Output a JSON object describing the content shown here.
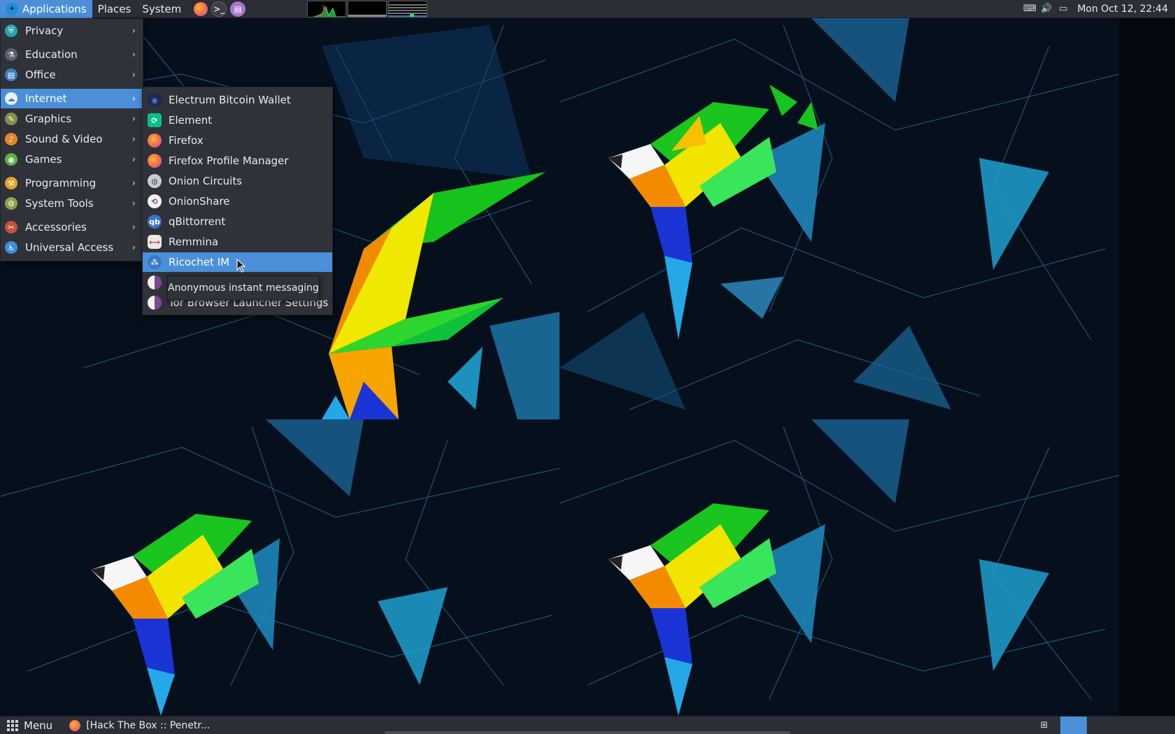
{
  "top_panel": {
    "applications": "Applications",
    "places": "Places",
    "system": "System",
    "clock": "Mon Oct 12, 22:44"
  },
  "main_menu": {
    "items": [
      {
        "label": "Privacy",
        "icon": "privacy-icon",
        "color": "#2aa1b3"
      },
      {
        "label": "Education",
        "icon": "education-icon",
        "color": "#5a6272"
      },
      {
        "label": "Office",
        "icon": "office-icon",
        "color": "#3d7ebf"
      },
      {
        "label": "Internet",
        "icon": "internet-icon",
        "color": "#e8eef5"
      },
      {
        "label": "Graphics",
        "icon": "graphics-icon",
        "color": "#8a8f4a"
      },
      {
        "label": "Sound & Video",
        "icon": "sound-video-icon",
        "color": "#e5862a"
      },
      {
        "label": "Games",
        "icon": "games-icon",
        "color": "#59b347"
      },
      {
        "label": "Programming",
        "icon": "programming-icon",
        "color": "#e3a32b"
      },
      {
        "label": "System Tools",
        "icon": "system-tools-icon",
        "color": "#8fa24a"
      },
      {
        "label": "Accessories",
        "icon": "accessories-icon",
        "color": "#c1533d"
      },
      {
        "label": "Universal Access",
        "icon": "universal-access-icon",
        "color": "#3d8fd8"
      }
    ],
    "selected": "Internet"
  },
  "internet_submenu": {
    "items": [
      {
        "label": "Electrum Bitcoin Wallet",
        "icon": "electrum-icon",
        "color": "#2b4fa8"
      },
      {
        "label": "Element",
        "icon": "element-icon",
        "color": "#0dbd8b"
      },
      {
        "label": "Firefox",
        "icon": "firefox-icon",
        "color": "#ff7139"
      },
      {
        "label": "Firefox Profile Manager",
        "icon": "firefox-profile-icon",
        "color": "#ff7139"
      },
      {
        "label": "Onion Circuits",
        "icon": "onion-circuits-icon",
        "color": "#9aa0a8"
      },
      {
        "label": "OnionShare",
        "icon": "onionshare-icon",
        "color": "#7d3a80"
      },
      {
        "label": "qBittorrent",
        "icon": "qbittorrent-icon",
        "color": "#3a72c4"
      },
      {
        "label": "Remmina",
        "icon": "remmina-icon",
        "color": "#c03f3f"
      },
      {
        "label": "Ricochet IM",
        "icon": "ricochet-icon",
        "color": "#4a8fd8"
      },
      {
        "label": "",
        "icon": "tor-browser-icon",
        "color": "#7d4698"
      },
      {
        "label": "Tor Browser Launcher Settings",
        "icon": "tor-settings-icon",
        "color": "#7d4698"
      }
    ],
    "selected": "Ricochet IM"
  },
  "tooltip": "Anonymous instant messaging",
  "bottom_panel": {
    "menu_label": "Menu",
    "task_label": "[Hack The Box :: Penetr..."
  },
  "colors": {
    "panel": "#2b2e35",
    "menu_bg": "#2f3239",
    "selection": "#4a8fd8"
  }
}
